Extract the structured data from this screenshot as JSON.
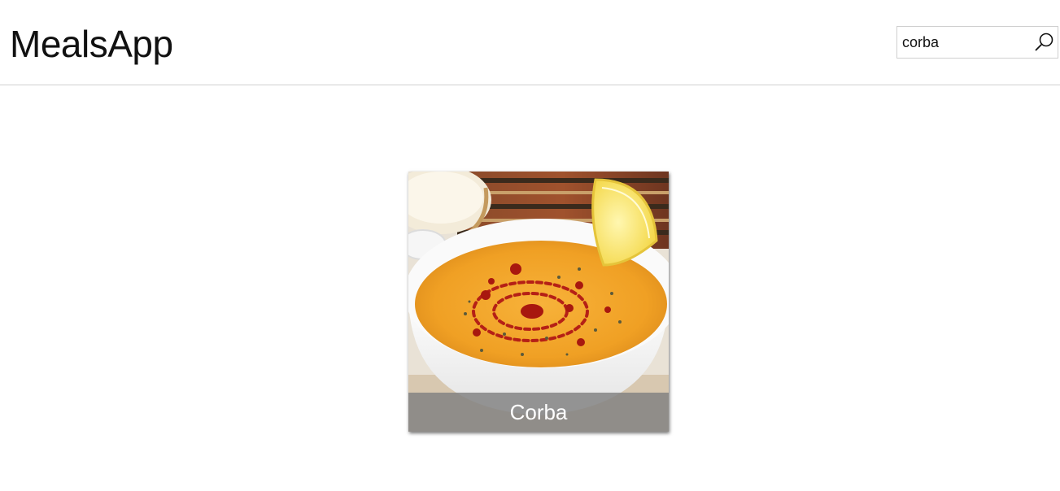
{
  "header": {
    "title": "MealsApp"
  },
  "search": {
    "value": "corba",
    "icon": "search-icon"
  },
  "meals": [
    {
      "name": "Corba"
    }
  ],
  "colors": {
    "caption_bg": "#808080",
    "divider": "#cfcfcf",
    "soup": "#f2a427"
  }
}
